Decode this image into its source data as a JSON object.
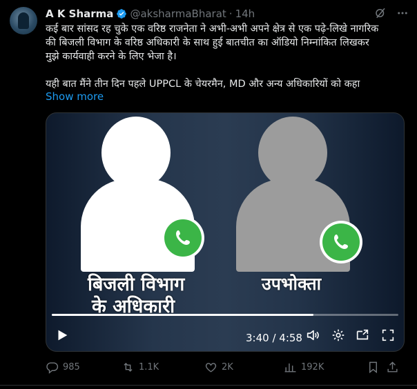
{
  "author": {
    "name": "A K Sharma",
    "handle": "@aksharmaBharat",
    "separator": "·",
    "time": "14h"
  },
  "tweet": {
    "line1": "कई बार सांसद रह चुके एक वरिष्ठ राजनेता ने अभी-अभी अपने क्षेत्र से एक पढ़े-लिखे नागरिक",
    "line2": "की बिजली विभाग के वरिष्ठ अधिकारी के साथ हुई बातचीत का ऑडियो निम्नांकित  लिखकर",
    "line3": "मुझे कार्यवाही करने के लिए भेजा है।",
    "line4": "यही बात मैंने तीन दिन पहले UPPCL के  चेयरमैन, MD और अन्य अधिकारियों को कहा",
    "show_more": "Show more"
  },
  "media": {
    "caption_left_line1": "बिजली विभाग",
    "caption_left_line2": "के अधिकारी",
    "caption_right": "उपभोक्ता",
    "current_time": "3:40",
    "duration": "4:58",
    "time_display": "3:40 / 4:58",
    "progress_fraction": 0.754
  },
  "actions": {
    "replies": "985",
    "reposts": "1.1K",
    "likes": "2K",
    "views": "192K"
  },
  "colors": {
    "accent": "#1d9bf0",
    "verified": "#1d9bf0",
    "whatsapp": "#3bb547",
    "muted": "#71767b"
  }
}
